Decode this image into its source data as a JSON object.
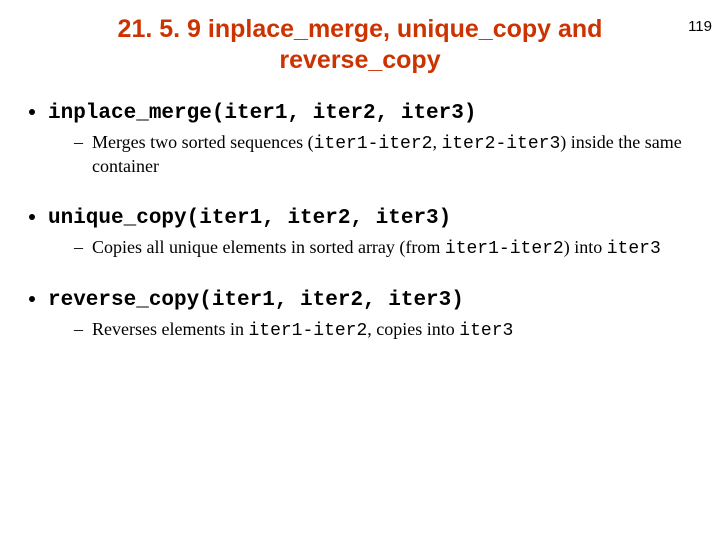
{
  "page_number": "119",
  "title": "21. 5. 9 inplace_merge, unique_copy and reverse_copy",
  "items": [
    {
      "fn": "inplace_merge(iter1, iter2, iter3)",
      "sub": {
        "pre": "Merges two sorted sequences (",
        "code1": "iter1-iter2",
        "mid": ", ",
        "code2": "iter2-iter3",
        "post": ") inside the same container"
      }
    },
    {
      "fn": "unique_copy(iter1, iter2, iter3)",
      "sub": {
        "pre": "Copies all unique elements in sorted array (from ",
        "code1": "iter1-iter2",
        "mid": ") into ",
        "code2": "iter3",
        "post": ""
      }
    },
    {
      "fn": "reverse_copy(iter1, iter2, iter3)",
      "sub": {
        "pre": "Reverses elements in ",
        "code1": "iter1-iter2",
        "mid": ", copies into ",
        "code2": "iter3",
        "post": ""
      }
    }
  ]
}
